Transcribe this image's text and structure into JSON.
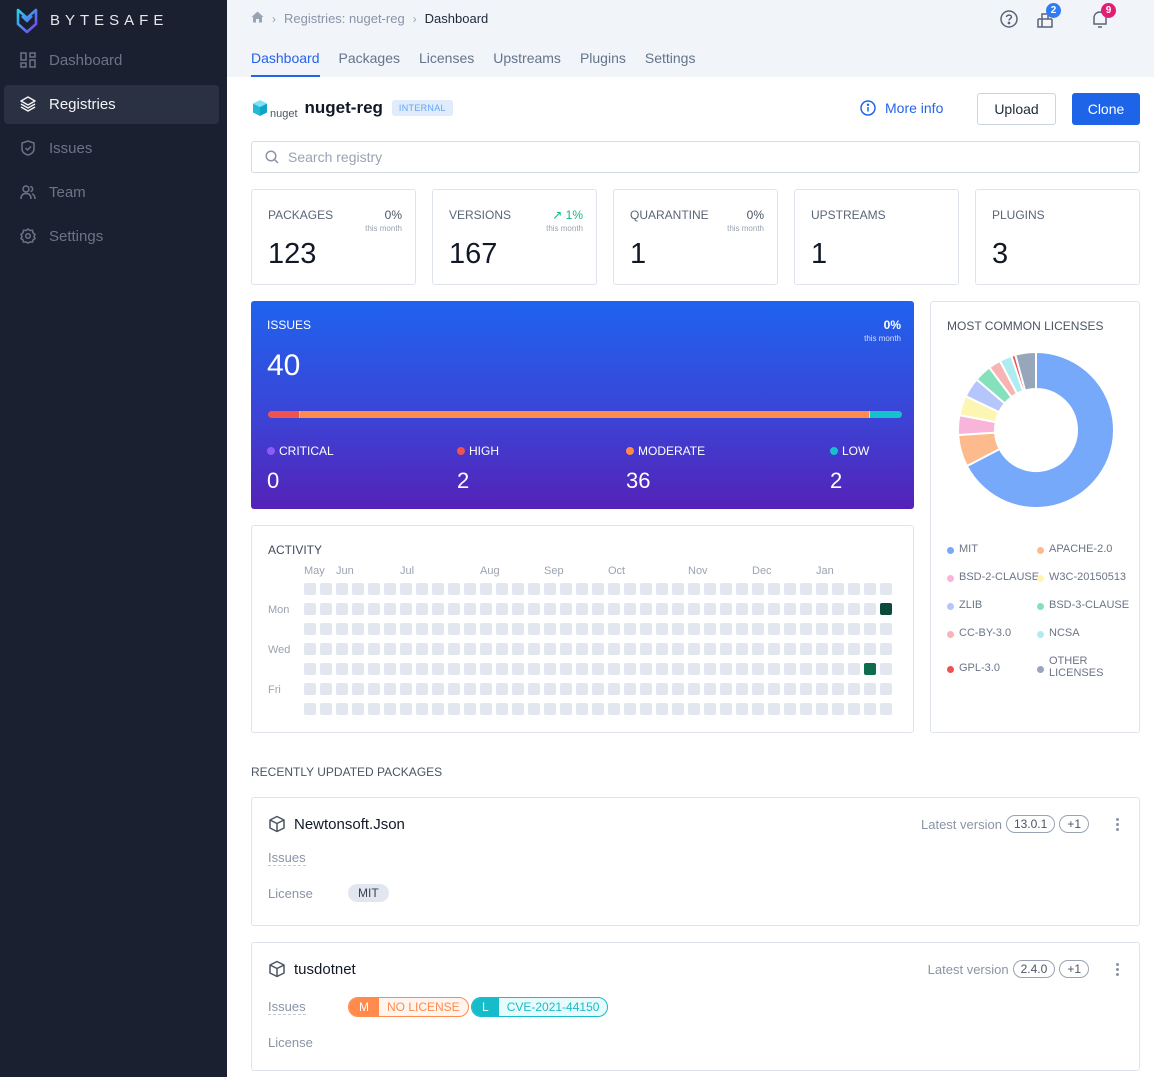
{
  "app": {
    "brand": "BYTESAFE"
  },
  "sidebar": {
    "items": [
      {
        "label": "Dashboard",
        "icon": "dashboard-icon",
        "active": false
      },
      {
        "label": "Registries",
        "icon": "layers-icon",
        "active": true
      },
      {
        "label": "Issues",
        "icon": "shield-check-icon",
        "active": false
      },
      {
        "label": "Team",
        "icon": "users-icon",
        "active": false
      },
      {
        "label": "Settings",
        "icon": "gear-icon",
        "active": false
      }
    ]
  },
  "header": {
    "breadcrumb": [
      {
        "label": "home",
        "icon": "home-icon"
      },
      {
        "label": "Registries: nuget-reg"
      },
      {
        "label": "Dashboard"
      }
    ],
    "tabs": [
      {
        "label": "Dashboard",
        "active": true
      },
      {
        "label": "Packages"
      },
      {
        "label": "Licenses"
      },
      {
        "label": "Upstreams"
      },
      {
        "label": "Plugins"
      },
      {
        "label": "Settings"
      }
    ],
    "icons": {
      "help": "help-icon",
      "packages": {
        "icon": "package-icon",
        "badge": "2",
        "badge_color": "#2f7cf6"
      },
      "notifications": {
        "icon": "bell-icon",
        "badge": "9",
        "badge_color": "#e11d74"
      }
    }
  },
  "registry": {
    "type": "nuget",
    "name": "nuget-reg",
    "visibility": "INTERNAL",
    "more_info_label": "More info",
    "upload_label": "Upload",
    "clone_label": "Clone",
    "search_placeholder": "Search registry"
  },
  "stats": [
    {
      "label": "PACKAGES",
      "value": "123",
      "change": "0%",
      "change_sub": "this month",
      "trend": "flat"
    },
    {
      "label": "VERSIONS",
      "value": "167",
      "change": "1%",
      "change_sub": "this month",
      "trend": "up"
    },
    {
      "label": "QUARANTINE",
      "value": "1",
      "change": "0%",
      "change_sub": "this month",
      "trend": "flat"
    },
    {
      "label": "UPSTREAMS",
      "value": "1"
    },
    {
      "label": "PLUGINS",
      "value": "3"
    }
  ],
  "issues": {
    "label": "ISSUES",
    "total": "40",
    "change": "0%",
    "change_sub": "this month",
    "severities": [
      {
        "name": "CRITICAL",
        "count": 0,
        "color": "#8b5cf6"
      },
      {
        "name": "HIGH",
        "count": 2,
        "color": "#ef5350"
      },
      {
        "name": "MODERATE",
        "count": 36,
        "color": "#ff8a4c"
      },
      {
        "name": "LOW",
        "count": 2,
        "color": "#16c0cf"
      }
    ]
  },
  "activity": {
    "title": "ACTIVITY",
    "months": [
      "May",
      "Jun",
      "Jul",
      "Aug",
      "Sep",
      "Oct",
      "Nov",
      "Dec",
      "Jan"
    ],
    "day_labels": [
      "Mon",
      "Wed",
      "Fri"
    ],
    "weeks": 37,
    "empty_color": "#e2e7ef",
    "active_cells": [
      {
        "week": 36,
        "day": 1,
        "level": 2,
        "color": "#0b4a3a"
      },
      {
        "week": 35,
        "day": 4,
        "level": 1,
        "color": "#0d6b4e"
      }
    ]
  },
  "licenses": {
    "title": "MOST COMMON LICENSES"
  },
  "chart_data": {
    "type": "pie",
    "title": "MOST COMMON LICENSES",
    "categories": [
      "MIT",
      "APACHE-2.0",
      "BSD-2-CLAUSE",
      "W3C-20150513",
      "ZLIB",
      "BSD-3-CLAUSE",
      "CC-BY-3.0",
      "NCSA",
      "GPL-3.0",
      "OTHER LICENSES"
    ],
    "values": [
      66,
      6.5,
      4,
      4,
      4,
      3.5,
      2.5,
      2.5,
      0.8,
      4.2
    ],
    "colors": [
      "#76a9fa",
      "#fdba8c",
      "#f8b4d9",
      "#fdf6b2",
      "#b4c6fc",
      "#84e1bc",
      "#f8b4b4",
      "#afecef",
      "#f05252",
      "#97a6ba"
    ],
    "legend": "bottom",
    "donut": true
  },
  "recent": {
    "title": "RECENTLY UPDATED PACKAGES",
    "latest_label": "Latest version",
    "issues_label": "Issues",
    "license_label": "License",
    "packages": [
      {
        "name": "Newtonsoft.Json",
        "version": "13.0.1",
        "more_versions": "+1",
        "issues": [],
        "license": "MIT"
      },
      {
        "name": "tusdotnet",
        "version": "2.4.0",
        "more_versions": "+1",
        "issues": [
          {
            "severity": "M",
            "text": "NO LICENSE",
            "color": "#ff8a4c",
            "bg": "#fff4ee"
          },
          {
            "severity": "L",
            "text": "CVE-2021-44150",
            "color": "#16bcc9",
            "bg": "#e8fbfc"
          }
        ],
        "license": ""
      }
    ]
  }
}
